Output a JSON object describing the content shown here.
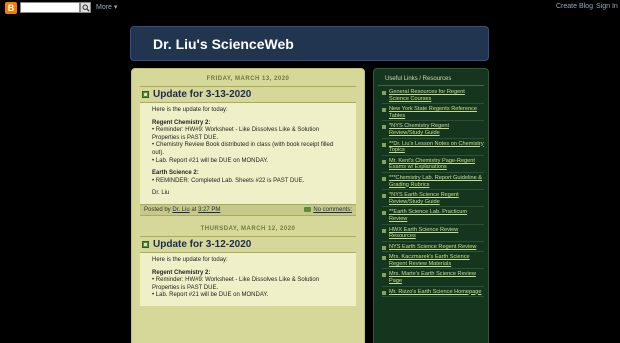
{
  "navbar": {
    "logo": "B",
    "more_label": "More ▾",
    "create_blog": "Create Blog",
    "sign_in": "Sign In"
  },
  "header": {
    "title": "Dr. Liu's ScienceWeb"
  },
  "posts": [
    {
      "date": "FRIDAY, MARCH 13, 2020",
      "title": "Update for 3-13-2020",
      "intro": "Here is the update for today:",
      "chem_heading": "Regent Chemistry 2:",
      "chem_lines": [
        "• Reminder:  HW#9:  Worksheet - Like Dissolves Like & Solution Properties is PAST DUE.",
        "• Chemistry Review Book distributed in class (with book receipt filled out).",
        "• Lab. Report #21 will be DUE on MONDAY."
      ],
      "earth_heading": "Earth Science 2:",
      "earth_lines": [
        "• REMINDER:  Completed Lab. Sheets #22 is PAST DUE."
      ],
      "signature": "Dr. Liu",
      "footer": {
        "posted_by": "Posted by",
        "author": "Dr. Liu",
        "at": "at",
        "time": "3:27 PM",
        "comments": "No comments:"
      }
    },
    {
      "date": "THURSDAY, MARCH 12, 2020",
      "title": "Update for 3-12-2020",
      "intro": "Here is the update for today:",
      "chem_heading": "Regent Chemistry 2:",
      "chem_lines": [
        "• Reminder:  HW#9:  Worksheet - Like Dissolves Like & Solution Properties is PAST DUE.",
        "• Lab. Report #21 will be DUE on MONDAY."
      ]
    }
  ],
  "sidebar": {
    "title": "Useful Links / Resources",
    "links": [
      "General Resources for Regent Science Courses",
      "New York State Regents Reference Tables",
      "*NYS Chemistry Regent Review/Study Guide",
      "**Dr. Liu's Lesson Notes on Chemistry Topics",
      "Mr. Kent's Chemistry Page-Regent Exams w/ Explanations",
      "***Chemistry Lab. Report Guideline & Grading Rubrics",
      "*NYS Earth Science Regent Review/Study Guide",
      "**Earth Science Lab. Practicum Review",
      "HWX Earth Science Review Resources",
      "NYS Earth Science Regent Review",
      "Mrs. Kaczmarek's Earth Science Regent Review Materials",
      "Mrs. Marte's Earth Science Review Page",
      "Mr. Rizzo's Earth Science Homepage"
    ]
  },
  "colors": {
    "header_bg": "#223550",
    "main_bg": "#d6d89a",
    "sidebar_bg": "#15351f",
    "link_green": "#c3e08e"
  }
}
